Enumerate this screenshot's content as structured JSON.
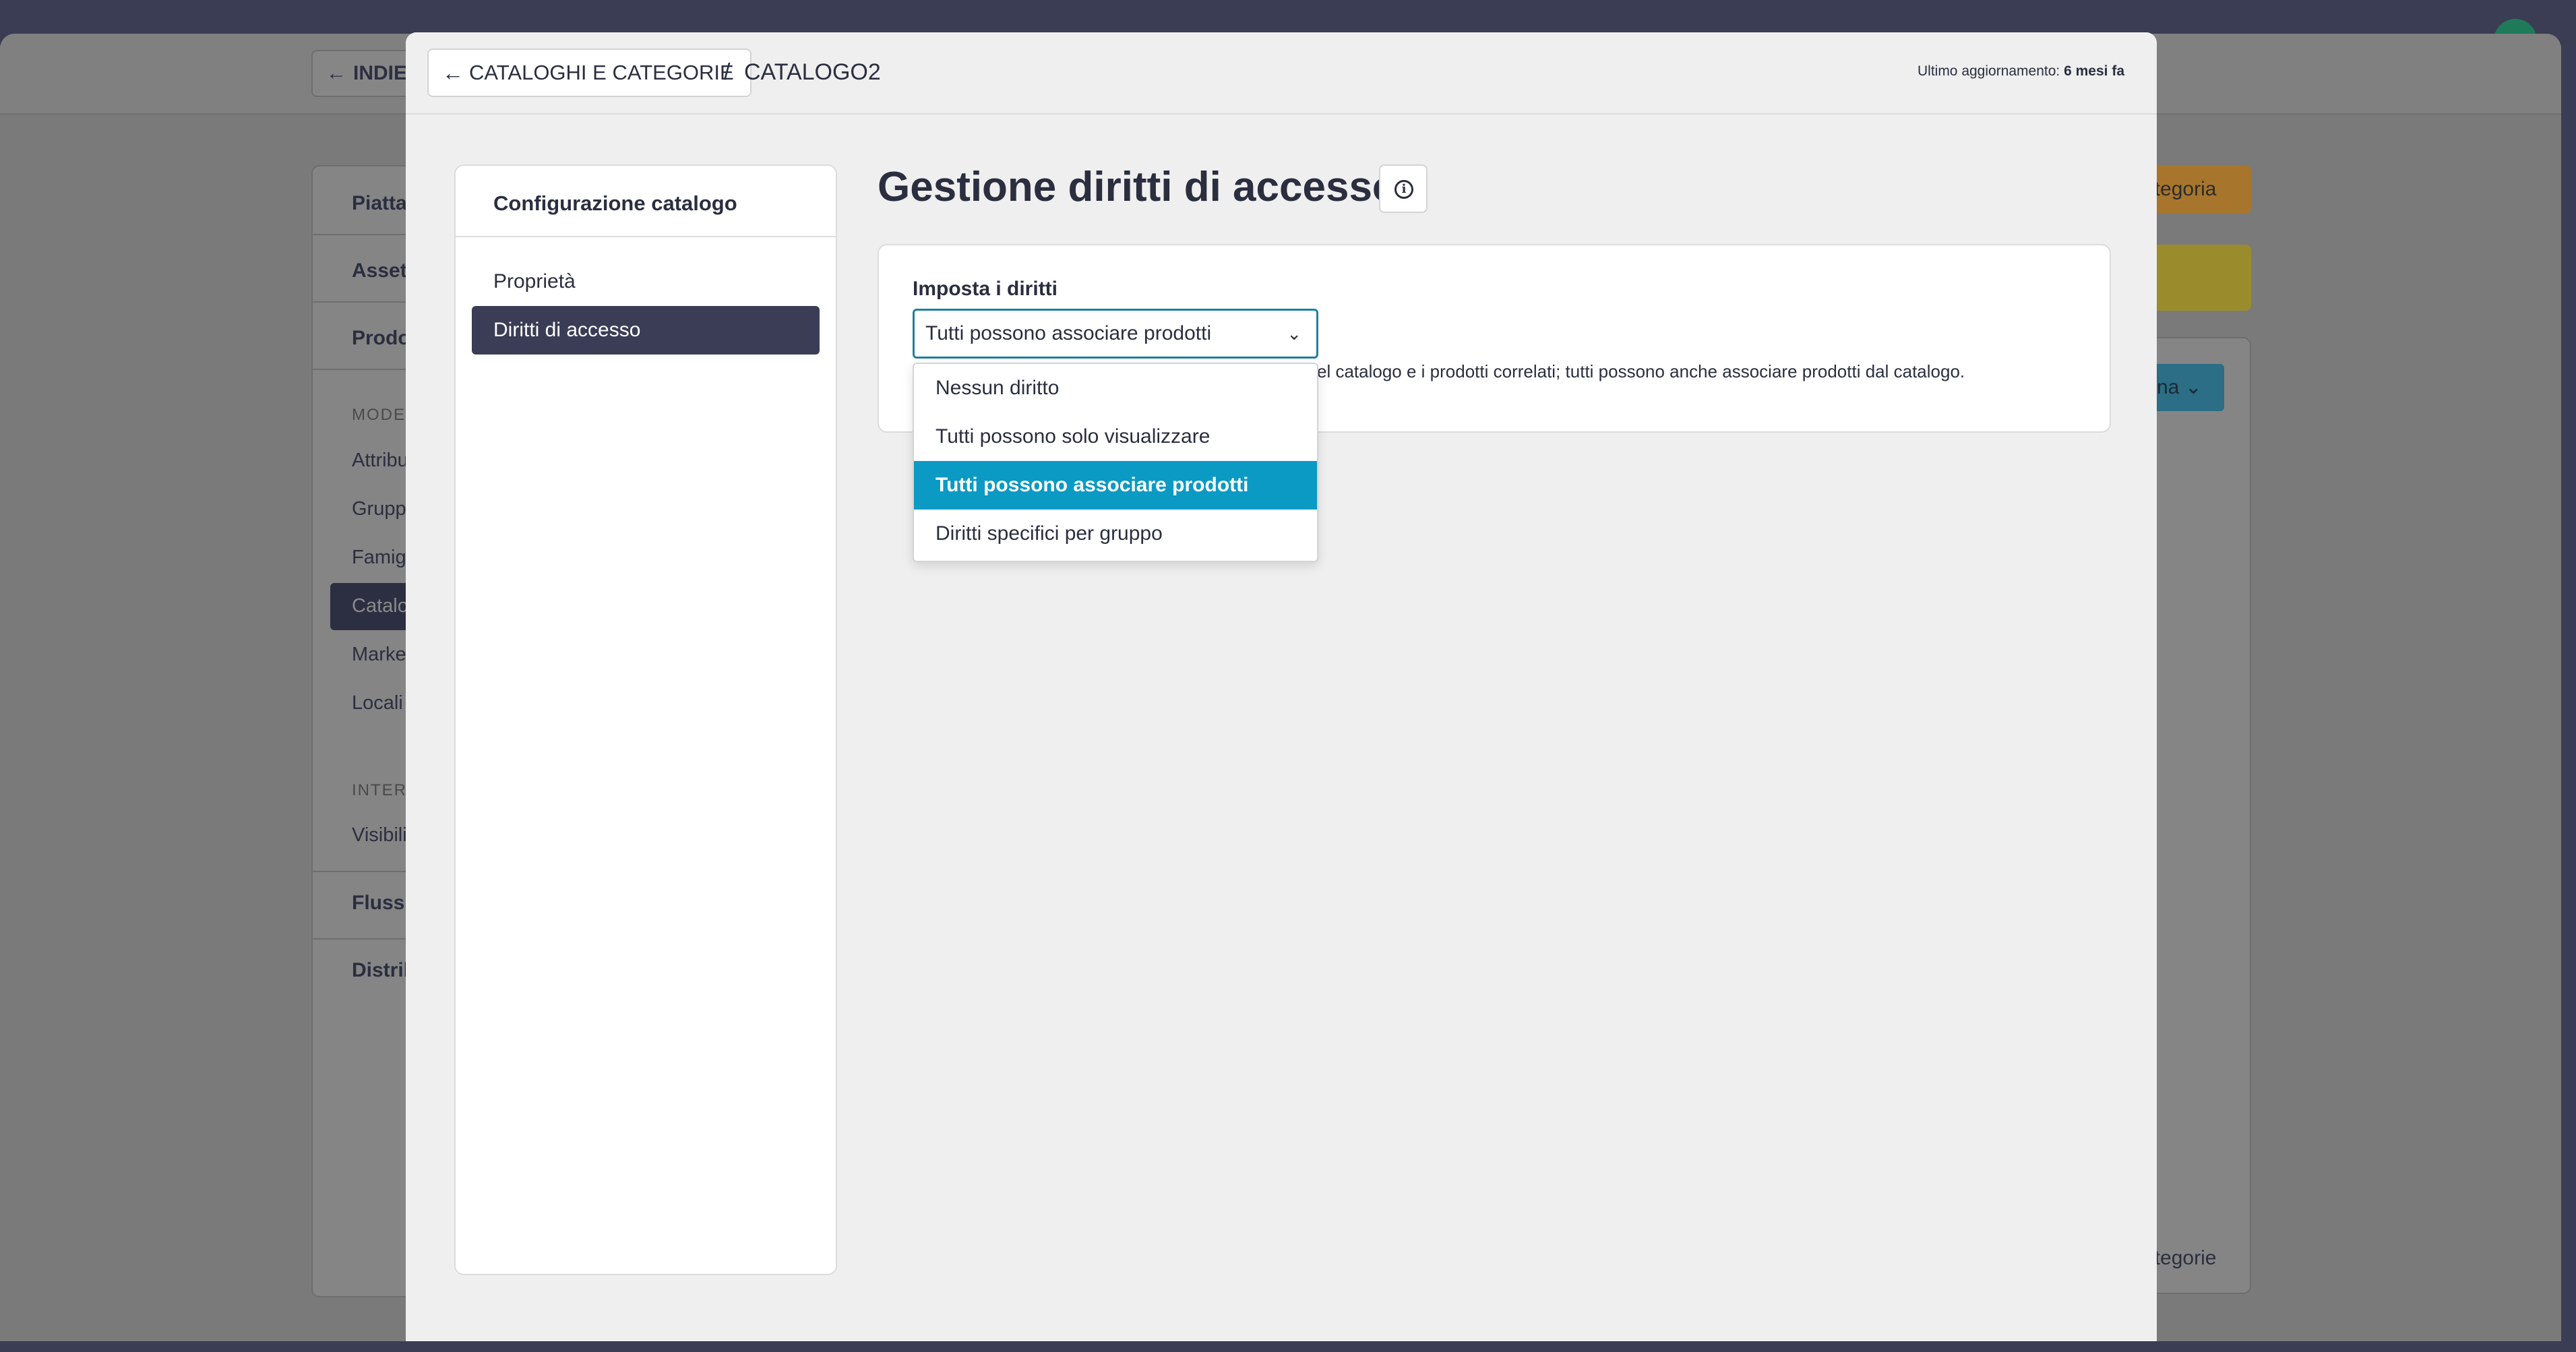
{
  "background_app": {
    "back_label": "INDIE",
    "sidebar": {
      "items": [
        "Piatta",
        "Asset",
        "Prodo"
      ],
      "section_model": "MODEL",
      "sub_items": [
        "Attribu",
        "Grupp",
        "Famig",
        "Catalo",
        "Marke",
        "Locali"
      ],
      "section_interface": "INTERF",
      "interface_items": [
        "Visibili"
      ],
      "bottom_items": [
        "Flussi",
        "Distrib"
      ]
    },
    "right_panel": {
      "orange_button_label": "ategoria",
      "teal_button_label": "na",
      "footer_link": "ategorie"
    }
  },
  "modal": {
    "breadcrumb": {
      "back_label": "CATALOGHI E CATEGORIE",
      "separator": "/",
      "current": "CATALOGO2"
    },
    "last_updated": {
      "label": "Ultimo aggiornamento:",
      "value": "6 mesi fa"
    },
    "nav": {
      "title": "Configurazione catalogo",
      "items": [
        {
          "label": "Proprietà",
          "active": false
        },
        {
          "label": "Diritti di accesso",
          "active": true
        }
      ]
    },
    "page_title": "Gestione diritti di accesso",
    "access_card": {
      "field_label": "Imposta i diritti",
      "select_value": "Tutti possono associare prodotti",
      "help_text": "el catalogo e i prodotti correlati; tutti possono anche associare prodotti dal catalogo.",
      "options": [
        {
          "label": "Nessun diritto",
          "selected": false
        },
        {
          "label": "Tutti possono solo visualizzare",
          "selected": false
        },
        {
          "label": "Tutti possono associare prodotti",
          "selected": true
        },
        {
          "label": "Diritti specifici per gruppo",
          "selected": false
        }
      ]
    }
  },
  "colors": {
    "modal_background": "#efefef",
    "nav_active": "#3a3d55",
    "option_selected": "#0b9ac4",
    "select_border": "#1e7fa3",
    "text": "#2b2e3f"
  }
}
